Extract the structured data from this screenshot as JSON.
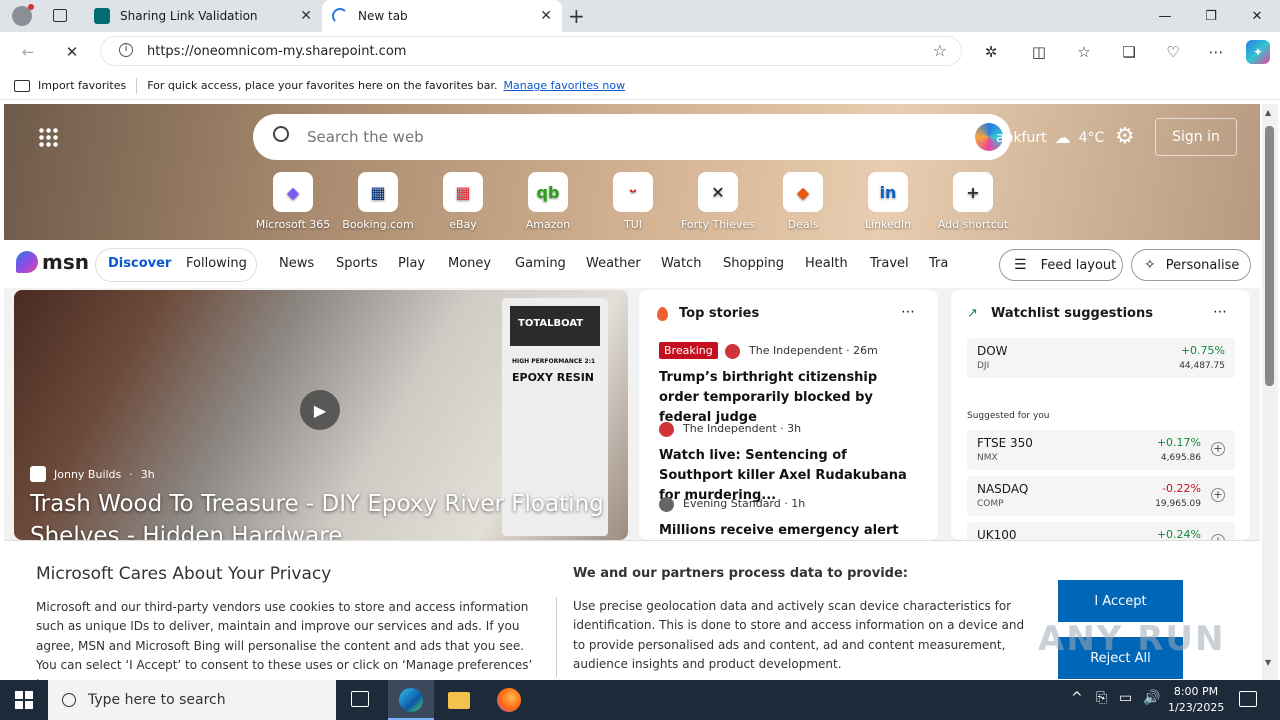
{
  "tabs": [
    {
      "title": "Sharing Link Validation",
      "color": "#036c70"
    },
    {
      "title": "New tab",
      "color": "#2a7ae2"
    }
  ],
  "address": {
    "url": "https://oneomnicom-my.sharepoint.com"
  },
  "favorites": {
    "import": "Import favorites",
    "message": "For quick access, place your favorites here on the favorites bar.",
    "manage": "Manage favorites now"
  },
  "search": {
    "placeholder": "Search the web"
  },
  "weather": {
    "location": "ankfurt",
    "temp": "4°C"
  },
  "signin": "Sign in",
  "shortcuts": [
    {
      "label": "Microsoft 365",
      "glyph": "◆",
      "color": "#7a5af5"
    },
    {
      "label": "Booking.com",
      "glyph": "▦",
      "color": "#003580"
    },
    {
      "label": "eBay",
      "glyph": "▦",
      "color": "#e53238"
    },
    {
      "label": "Amazon",
      "glyph": "qb",
      "color": "#2ca01c"
    },
    {
      "label": "TUI",
      "glyph": "ᵕ",
      "color": "#d40e14"
    },
    {
      "label": "Forty Thieves",
      "glyph": "✕",
      "color": "#222"
    },
    {
      "label": "Deals",
      "glyph": "◆",
      "color": "#e8590c"
    },
    {
      "label": "LinkedIn",
      "glyph": "in",
      "color": "#0a66c2"
    },
    {
      "label": "Add shortcut",
      "glyph": "+",
      "color": "#333"
    }
  ],
  "msn": {
    "logo": "msn",
    "discover": "Discover",
    "following": "Following",
    "nav": [
      "News",
      "Sports",
      "Play",
      "Money",
      "Gaming",
      "Weather",
      "Watch",
      "Shopping",
      "Health",
      "Travel",
      "Tra"
    ],
    "feed_layout": "Feed layout",
    "personalise": "Personalise"
  },
  "article": {
    "source": "Jonny Builds",
    "age": "3h",
    "title": "Trash Wood To Treasure - DIY Epoxy River Floating Shelves - Hidden Hardware",
    "can_lines": [
      "TOTALBOAT",
      "HIGH PERFORMANCE 2:1",
      "EPOXY RESIN"
    ]
  },
  "top_stories": {
    "title": "Top stories",
    "items": [
      {
        "badge": "Breaking",
        "source": "The Independent",
        "age": "26m",
        "headline": "Trump’s birthright citizenship order temporarily blocked by federal judge"
      },
      {
        "badge": "",
        "source": "The Independent",
        "age": "3h",
        "headline": "Watch live: Sentencing of Southport killer Axel Rudakubana for murdering..."
      },
      {
        "badge": "",
        "source": "Evening Standard",
        "age": "1h",
        "headline": "Millions receive emergency alert amid"
      }
    ]
  },
  "watchlist": {
    "title": "Watchlist suggestions",
    "top": {
      "name": "DOW",
      "sub": "DJI",
      "change": "+0.75%",
      "value": "44,487.75"
    },
    "suggested_label": "Suggested for you",
    "items": [
      {
        "name": "FTSE 350",
        "sub": "NMX",
        "change": "+0.17%",
        "value": "4,695.86",
        "positive": true
      },
      {
        "name": "NASDAQ",
        "sub": "COMP",
        "change": "-0.22%",
        "value": "19,965.09",
        "positive": false
      },
      {
        "name": "UK100",
        "sub": "",
        "change": "+0.24%",
        "value": "",
        "positive": true
      }
    ]
  },
  "privacy": {
    "title": "Microsoft Cares About Your Privacy",
    "body": "Microsoft and our third-party vendors use cookies to store and access information such as unique IDs to deliver, maintain and improve our services and ads. If you agree, MSN and Microsoft Bing will personalise the content and ads that you see. You can select ‘I Accept’ to consent to these uses or click on ‘Manage preferences’ to",
    "subtitle": "We and our partners process data to provide:",
    "detail": "Use precise geolocation data and actively scan device characteristics for identification. This is done to store and access information on a device and to provide personalised ads and content, ad and content measurement, audience insights and product development.",
    "accept": "I Accept",
    "reject": "Reject All"
  },
  "watermark": "ANY RUN",
  "taskbar": {
    "search_placeholder": "Type here to search",
    "time": "8:00 PM",
    "date": "1/23/2025"
  }
}
